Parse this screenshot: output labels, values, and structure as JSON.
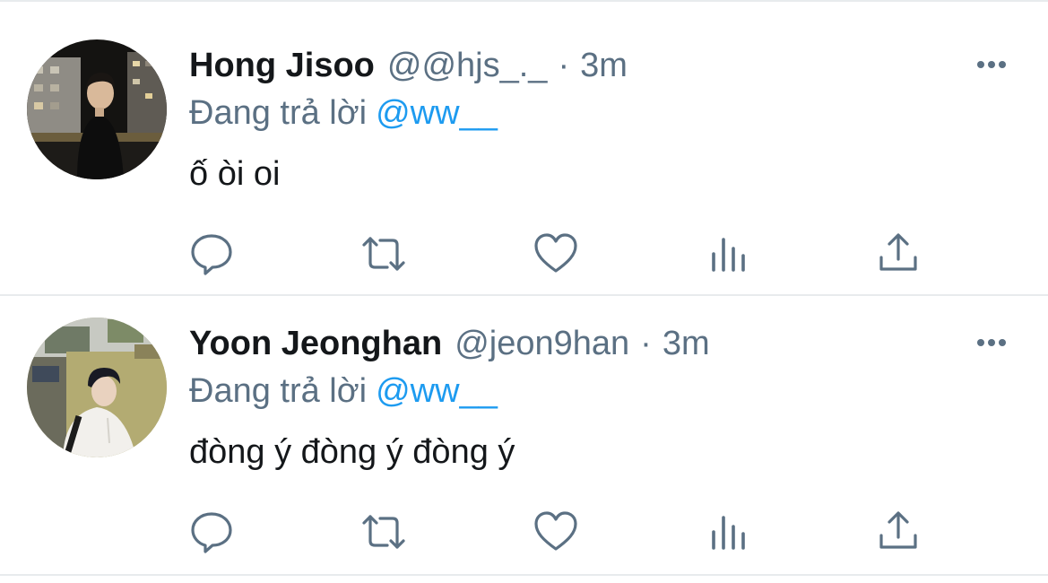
{
  "colors": {
    "text_primary": "#14171a",
    "text_secondary": "#5b7083",
    "accent": "#1d9bf0",
    "icon_gray": "#5b7083",
    "divider": "#e8ebed"
  },
  "tweets": [
    {
      "name": "Hong Jisoo",
      "handle": "@@hjs_._",
      "separator": "·",
      "time": "3m",
      "replying_prefix": "Đang trả lời",
      "replying_to": "@ww__",
      "text": "ố òi oi",
      "actions": [
        "reply-icon",
        "retweet-icon",
        "like-icon",
        "analytics-icon",
        "share-icon"
      ],
      "more_icon": "more-icon"
    },
    {
      "name": "Yoon Jeonghan",
      "handle": "@jeon9han",
      "separator": "·",
      "time": "3m",
      "replying_prefix": "Đang trả lời",
      "replying_to": "@ww__",
      "text": "đòng ý đòng ý đòng ý",
      "actions": [
        "reply-icon",
        "retweet-icon",
        "like-icon",
        "analytics-icon",
        "share-icon"
      ],
      "more_icon": "more-icon"
    }
  ]
}
